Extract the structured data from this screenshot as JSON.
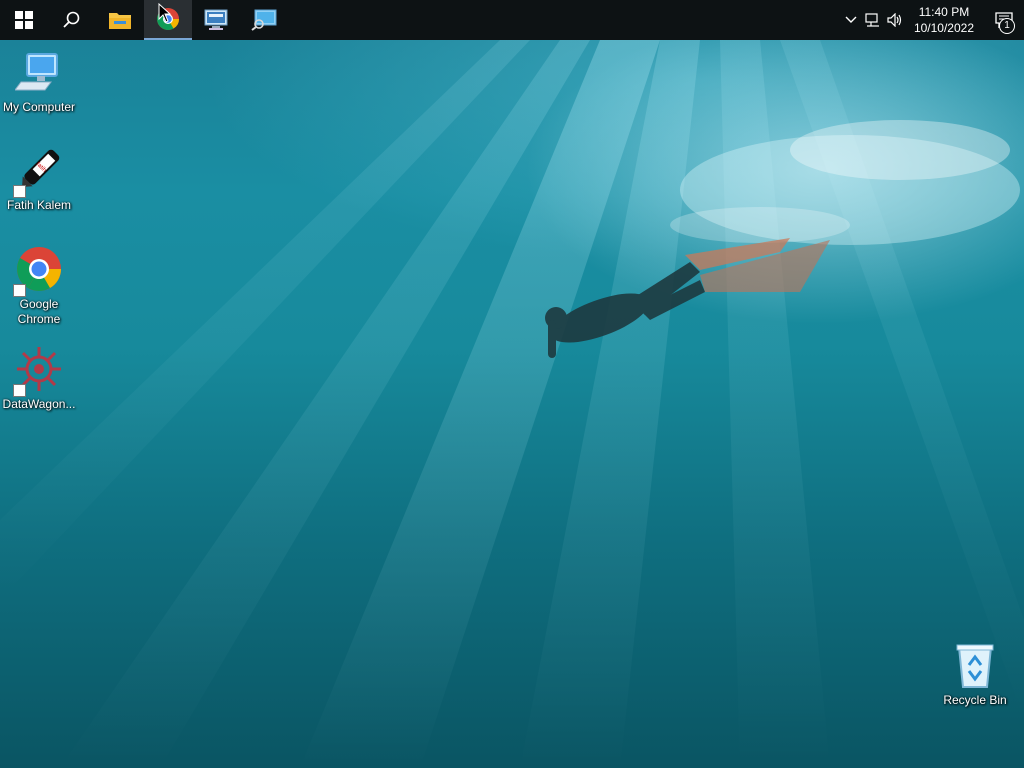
{
  "taskbar": {
    "apps": [
      {
        "name": "start",
        "icon": "windows-logo-icon"
      },
      {
        "name": "search",
        "icon": "search-icon"
      },
      {
        "name": "file-explorer",
        "icon": "folder-icon"
      },
      {
        "name": "google-chrome",
        "icon": "chrome-icon",
        "active": true
      },
      {
        "name": "remote-desktop",
        "icon": "monitor-icon"
      },
      {
        "name": "network-monitor",
        "icon": "monitor-search-icon"
      }
    ],
    "tray": {
      "icons": [
        "chevron-up-icon",
        "network-icon",
        "volume-icon"
      ],
      "time": "11:40 PM",
      "date": "10/10/2022",
      "notification_count": "1"
    }
  },
  "desktop": {
    "icons": [
      {
        "label": "My Computer",
        "icon": "computer-icon"
      },
      {
        "label": "Fatih Kalem",
        "icon": "pen-icon",
        "shortcut": true
      },
      {
        "label": "Google Chrome",
        "icon": "chrome-icon",
        "shortcut": true
      },
      {
        "label": "DataWagon...",
        "icon": "gear-flower-icon",
        "shortcut": true
      },
      {
        "label": "Recycle Bin",
        "icon": "recycle-bin-icon"
      }
    ],
    "wallpaper": "underwater freediver"
  },
  "colors": {
    "taskbar_bg": "#0d1214",
    "active_underline": "#7aa7d6",
    "water_top": "#1b7f96",
    "water_bottom": "#0a5563"
  }
}
